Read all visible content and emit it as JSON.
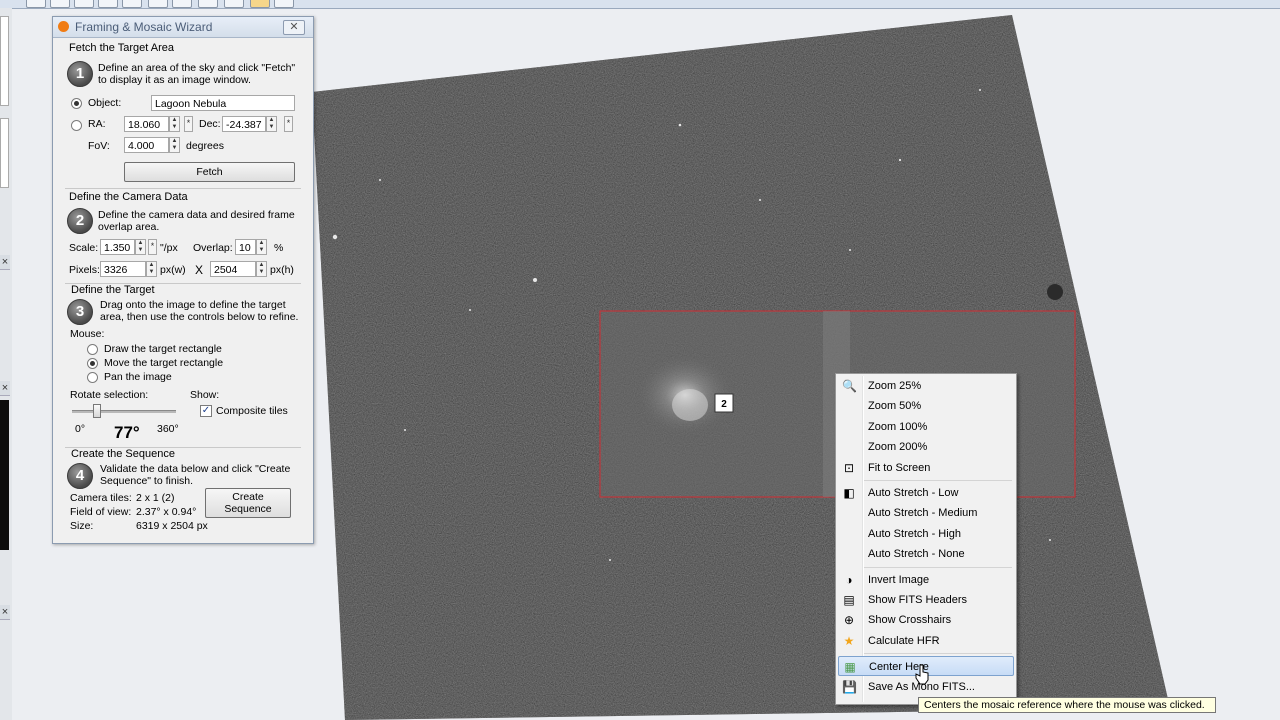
{
  "wizard": {
    "title": "Framing & Mosaic Wizard",
    "close_glyph": "✕",
    "fetch": {
      "heading": "Fetch the Target Area",
      "step": "1",
      "description_line1": "Define an area of the sky and click \"Fetch\"",
      "description_line2": "to display it as an image window.",
      "object_label": "Object:",
      "object_value": "Lagoon Nebula",
      "ra_label": "RA:",
      "ra_value": "18.060",
      "dec_label": "Dec:",
      "dec_value": "-24.387",
      "fov_label": "FoV:",
      "fov_value": "4.000",
      "fov_unit": "degrees",
      "fetch_button": "Fetch",
      "selected_mode": "object"
    },
    "camera": {
      "heading": "Define the Camera Data",
      "step": "2",
      "description_line1": "Define the camera data and desired frame",
      "description_line2": "overlap area.",
      "scale_label": "Scale:",
      "scale_value": "1.350",
      "scale_unit": "\"/px",
      "overlap_label": "Overlap:",
      "overlap_value": "10",
      "overlap_unit": "%",
      "pixels_label": "Pixels:",
      "width_value": "3326",
      "width_unit": "px(w)",
      "times": "X",
      "height_value": "2504",
      "height_unit": "px(h)"
    },
    "target": {
      "heading": "Define the Target",
      "step": "3",
      "description_line1": "Drag onto the image to define the target",
      "description_line2": "area, then use the controls below to refine.",
      "mouse_label": "Mouse:",
      "mouse_options": [
        "Draw the target rectangle",
        "Move the target rectangle",
        "Pan the image"
      ],
      "mouse_selected": 1,
      "rotate_label": "Rotate selection:",
      "rotate_min": "0°",
      "rotate_max": "360°",
      "rotate_value": "77°",
      "rotate_fraction": 0.214,
      "show_label": "Show:",
      "composite_label": "Composite tiles",
      "composite_checked": true
    },
    "sequence": {
      "heading": "Create the Sequence",
      "step": "4",
      "description_line1": "Validate the data below and click \"Create",
      "description_line2": "Sequence\" to finish.",
      "tiles_label": "Camera tiles:",
      "tiles_value": "2 x 1 (2)",
      "fov_label": "Field of view:",
      "fov_value": "2.37° x 0.94°",
      "size_label": "Size:",
      "size_value": "6319 x 2504 px",
      "create_line1": "Create",
      "create_line2": "Sequence"
    }
  },
  "mosaic": {
    "tile_label": "2",
    "border_color": "#c0353a"
  },
  "context_menu": {
    "groups": [
      [
        {
          "label": "Zoom 25%",
          "icon": "magnifier-icon"
        },
        {
          "label": "Zoom 50%",
          "icon": ""
        },
        {
          "label": "Zoom 100%",
          "icon": ""
        },
        {
          "label": "Zoom 200%",
          "icon": ""
        },
        {
          "label": "Fit to Screen",
          "icon": "fit-screen-icon"
        }
      ],
      [
        {
          "label": "Auto Stretch - Low",
          "icon": "stretch-icon"
        },
        {
          "label": "Auto Stretch - Medium",
          "icon": ""
        },
        {
          "label": "Auto Stretch - High",
          "icon": ""
        },
        {
          "label": "Auto Stretch - None",
          "icon": ""
        }
      ],
      [
        {
          "label": "Invert Image",
          "icon": "invert-icon"
        },
        {
          "label": "Show FITS Headers",
          "icon": "fits-header-icon"
        },
        {
          "label": "Show Crosshairs",
          "icon": "crosshair-icon"
        },
        {
          "label": "Calculate HFR",
          "icon": "star-icon"
        }
      ],
      [
        {
          "label": "Center Here",
          "icon": "grid-icon",
          "highlighted": true
        },
        {
          "label": "Save As Mono FITS...",
          "icon": "save-icon"
        }
      ]
    ]
  },
  "tooltip": "Centers the mosaic reference where the mouse was clicked."
}
